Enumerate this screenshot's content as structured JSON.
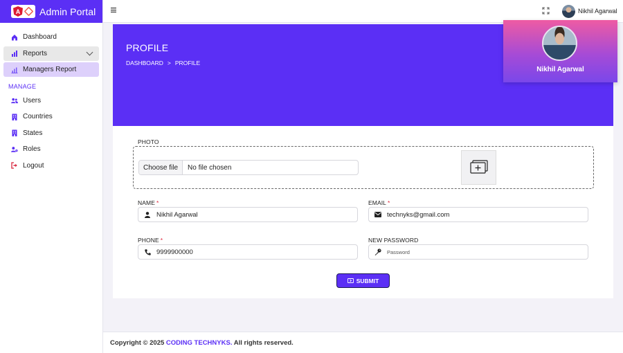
{
  "brand": {
    "title": "Admin Portal",
    "logo_letter": "A"
  },
  "sidebar": {
    "items": [
      {
        "label": "Dashboard",
        "icon": "home-icon"
      },
      {
        "label": "Reports",
        "icon": "bar-chart-icon"
      },
      {
        "label": "Managers Report",
        "icon": "bar-chart-outline-icon"
      }
    ],
    "section_title": "MANAGE",
    "manage_items": [
      {
        "label": "Users",
        "icon": "users-icon"
      },
      {
        "label": "Countries",
        "icon": "building-icon"
      },
      {
        "label": "States",
        "icon": "building-icon"
      },
      {
        "label": "Roles",
        "icon": "user-gear-icon"
      },
      {
        "label": "Logout",
        "icon": "logout-icon"
      }
    ]
  },
  "topbar": {
    "user_name": "Nikhil Agarwal",
    "menu_icon": "hamburger-icon",
    "fullscreen_icon": "fullscreen-icon"
  },
  "profile_card": {
    "name": "Nikhil Agarwal"
  },
  "page": {
    "title": "PROFILE",
    "breadcrumb": [
      "DASHBOARD",
      ">",
      "PROFILE"
    ]
  },
  "form": {
    "photo_label": "PHOTO",
    "file_button": "Choose file",
    "file_status": "No file chosen",
    "name": {
      "label": "NAME",
      "required": "*",
      "value": "Nikhil Agarwal"
    },
    "email": {
      "label": "EMAIL",
      "required": "*",
      "value": "technyks@gmail.com"
    },
    "phone": {
      "label": "PHONE",
      "required": "*",
      "value": "9999900000"
    },
    "password": {
      "label": "NEW PASSWORD",
      "placeholder": "Password"
    },
    "submit_label": "SUBMIT"
  },
  "footer": {
    "prefix": "Copyright © 2025 ",
    "brand": "CODING TECHNYKS.",
    "suffix": " All rights reserved."
  },
  "colors": {
    "accent": "#5b2ff5",
    "required": "#e0263c",
    "card_top": "#ee5ba3"
  }
}
